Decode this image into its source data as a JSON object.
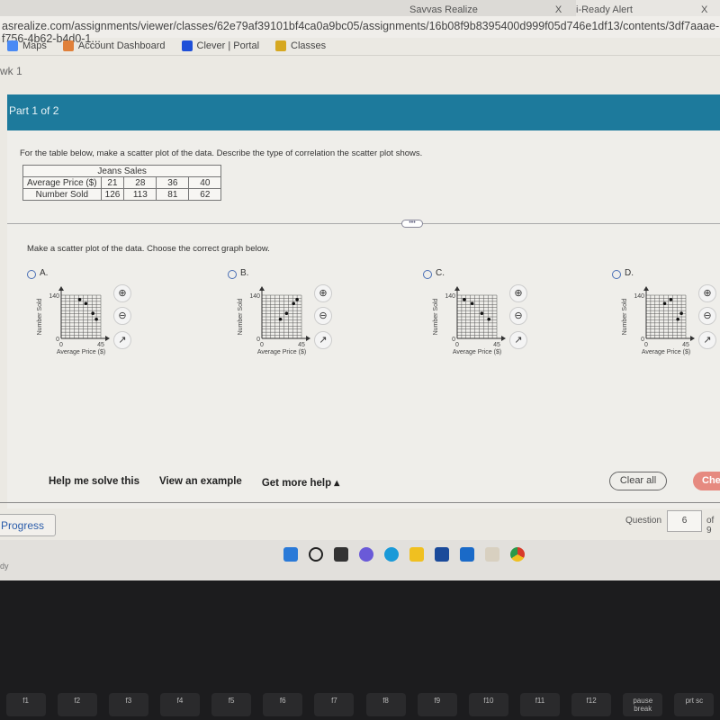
{
  "browser": {
    "tabs": [
      {
        "label": "Savvas Realize",
        "close": "X"
      },
      {
        "label": "i-Ready Alert",
        "close": "X"
      }
    ],
    "url": "asrealize.com/assignments/viewer/classes/62e79af39101bf4ca0a9bc05/assignments/16b08f9b8395400d999f05d746e1df13/contents/3df7aaae-f756-4b62-b4d0-1...",
    "bookmarks": [
      {
        "label": "Maps",
        "icon": "maps-icon",
        "color": "#4a8af4"
      },
      {
        "label": "Account Dashboard",
        "icon": "account-icon",
        "color": "#e0803a"
      },
      {
        "label": "Clever | Portal",
        "icon": "clever-icon",
        "color": "#1e4fd8"
      },
      {
        "label": "Classes",
        "icon": "classroom-icon",
        "color": "#d6a820"
      }
    ]
  },
  "breadcrumb": "wk 1",
  "banner": {
    "part": "Part 1 of 2",
    "color": "#1d7a9c"
  },
  "question": {
    "prompt": "For the table below, make a scatter plot of the data. Describe the type of correlation the scatter plot shows.",
    "table": {
      "title": "Jeans Sales",
      "rows": [
        {
          "label": "Average Price ($)",
          "values": [
            "21",
            "28",
            "36",
            "40"
          ]
        },
        {
          "label": "Number Sold",
          "values": [
            "126",
            "113",
            "81",
            "62"
          ]
        }
      ]
    },
    "more": "•••",
    "instruction": "Make a scatter plot of the data. Choose the correct graph below."
  },
  "options": [
    {
      "label": "A.",
      "points": [
        [
          21,
          126
        ],
        [
          28,
          113
        ],
        [
          36,
          81
        ],
        [
          40,
          62
        ]
      ]
    },
    {
      "label": "B.",
      "points": [
        [
          21,
          62
        ],
        [
          28,
          81
        ],
        [
          36,
          113
        ],
        [
          40,
          126
        ]
      ]
    },
    {
      "label": "C.",
      "points": [
        [
          8,
          126
        ],
        [
          17,
          113
        ],
        [
          28,
          81
        ],
        [
          36,
          62
        ]
      ]
    },
    {
      "label": "D.",
      "points": [
        [
          21,
          113
        ],
        [
          28,
          126
        ],
        [
          36,
          62
        ],
        [
          40,
          81
        ]
      ]
    }
  ],
  "chart_axes": {
    "xlabel": "Average Price ($)",
    "ylabel": "Number Sold",
    "xmin": "0",
    "xmax": "45",
    "ymin": "0",
    "ymax": "140"
  },
  "tools": {
    "zoom_in": "⊕",
    "zoom_out": "⊖",
    "popout": "↗"
  },
  "footer": {
    "help": "Help me solve this",
    "example": "View an example",
    "more_help": "Get more help ▴",
    "clear": "Clear all",
    "check": "Che",
    "progress": "Progress",
    "question_label": "Question",
    "question_num": "6",
    "of": "of 9"
  },
  "status": "dy",
  "keyboard": [
    "f1",
    "f2",
    "f3",
    "f4",
    "f5",
    "f6",
    "f7",
    "f8",
    "f9",
    "f10",
    "f11",
    "f12",
    "pause break",
    "prt sc"
  ]
}
